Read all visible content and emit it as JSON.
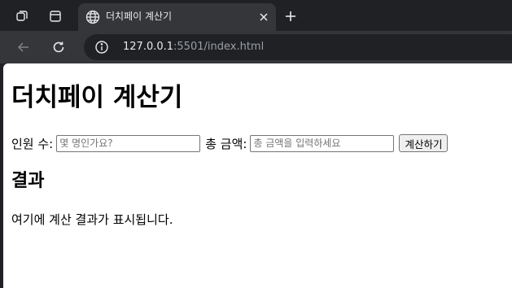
{
  "browser": {
    "tab": {
      "title": "더치페이 계산기"
    },
    "address": {
      "host": "127.0.0.1",
      "rest": ":5501/index.html"
    },
    "colors": {
      "frame": "#202124",
      "toolbar": "#35363a",
      "text": "#e8eaed",
      "muted": "#9aa0a6"
    }
  },
  "page": {
    "title": "더치페이 계산기",
    "form": {
      "people_label": "인원 수:",
      "people_placeholder": "몇 명인가요?",
      "amount_label": "총 금액:",
      "amount_placeholder": "총 금액을 입력하세요",
      "submit_label": "계산하기"
    },
    "result": {
      "heading": "결과",
      "text": "여기에 계산 결과가 표시됩니다."
    }
  }
}
